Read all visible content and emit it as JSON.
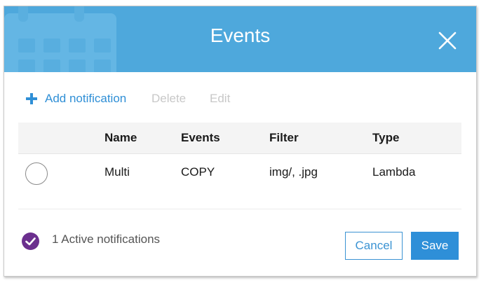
{
  "header": {
    "title": "Events",
    "bg_icon": "calendar-icon",
    "close_icon": "close-icon",
    "bg_color": "#4ea8dc"
  },
  "toolbar": {
    "add_label": "Add notification",
    "add_icon": "plus-icon",
    "delete_label": "Delete",
    "edit_label": "Edit",
    "accent_color": "#2f8fd6",
    "disabled_color": "#c8c8c8"
  },
  "table": {
    "columns": [
      "Name",
      "Events",
      "Filter",
      "Type"
    ],
    "rows": [
      {
        "selected": false,
        "cells": [
          "Multi",
          "COPY",
          "img/, .jpg",
          "Lambda"
        ]
      }
    ]
  },
  "footer": {
    "status_icon": "check-circle-icon",
    "status_color": "#6b2f8e",
    "status_text": "1 Active notifications",
    "cancel_label": "Cancel",
    "save_label": "Save"
  }
}
